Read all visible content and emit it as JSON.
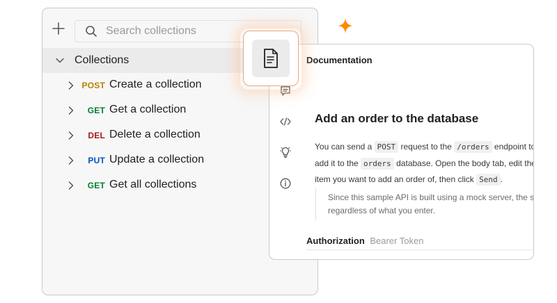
{
  "sidebar": {
    "search": {
      "placeholder": "Search collections"
    },
    "tree_header": "Collections",
    "requests": [
      {
        "method": "POST",
        "method_color": "#B98000",
        "name": "Create a collection"
      },
      {
        "method": "GET",
        "method_color": "#007F31",
        "name": "Get a collection"
      },
      {
        "method": "DEL",
        "method_color": "#A51B1B",
        "name": "Delete a collection"
      },
      {
        "method": "PUT",
        "method_color": "#0052C2",
        "name": "Update a collection"
      },
      {
        "method": "GET",
        "method_color": "#007F31",
        "name": "Get all collections"
      }
    ]
  },
  "doc": {
    "title": "Documentation",
    "heading": "Add an order to the database",
    "para": {
      "t1": "You can send a ",
      "c1": "POST",
      "t2": " request to the ",
      "c2": "/orders",
      "t3": " endpoint to",
      "t4": "add it to the ",
      "c3": "orders",
      "t5": " database. Open the body tab, edit the",
      "t6": "item you want to add an order of, then click ",
      "c4": "Send",
      "t7": "."
    },
    "note": {
      "line1": "Since this sample API is built using a mock server, the sa",
      "line2": "regardless of what you enter."
    },
    "auth_label": "Authorization",
    "auth_value": "Bearer Token"
  },
  "icons": {
    "sidebar": [
      "plus-icon",
      "search-icon",
      "chevron-down-icon",
      "chevron-right-icon"
    ],
    "doc_side": [
      "comment-icon",
      "code-icon",
      "lightbulb-icon",
      "info-icon"
    ],
    "highlight": "document-icon",
    "decoration": "sparkle-icon"
  },
  "colors": {
    "accent_orange": "#F6A26B",
    "sparkle": "#FF8A00"
  }
}
